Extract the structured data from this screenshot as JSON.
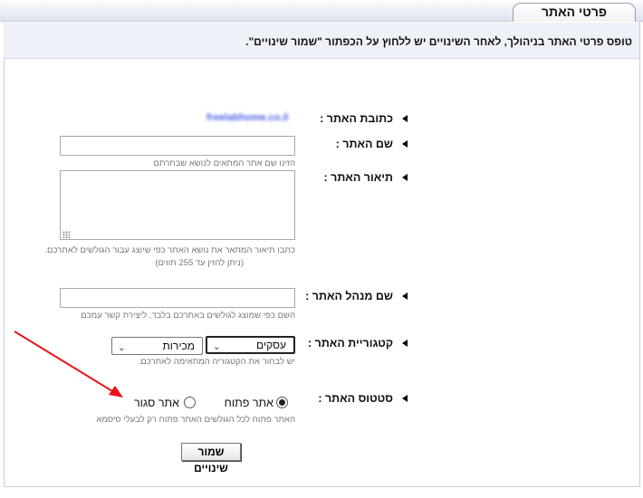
{
  "header": {
    "tab_title": "פרטי האתר"
  },
  "info": {
    "text": "טופס פרטי האתר בניהולך, לאחר השינויים יש ללחוץ על הכפתור \"שמור שינויים\"."
  },
  "form": {
    "site_address": {
      "label": "כתובת האתר :",
      "value": "freelabhome.co.il"
    },
    "site_name": {
      "label": "שם האתר :",
      "value": "",
      "help": "הזינו שם אתר המתאים לנושא שבחרתם"
    },
    "site_description": {
      "label": "תיאור האתר :",
      "value": "",
      "help1": "כתבו תיאור המתאר את נושא האתר כפי שיוצג עבור הגולשים לאתרכם.",
      "help2": "(ניתן להזין עד 255 תווים)"
    },
    "admin_name": {
      "label": "שם מנהל האתר :",
      "value": "",
      "help": "השם כפי שמוצג לגולשים באתרכם בלבד, ליצירת קשר עמכם"
    },
    "category": {
      "label": "קטגוריית האתר :",
      "main_value": "עסקים",
      "sub_value": "מכירות",
      "help": "יש לבחור את הקטגוריה המתאימה לאתרכם."
    },
    "site_status": {
      "label": "סטטוס האתר :",
      "open_label": "אתר פתוח",
      "closed_label": "אתר סגור",
      "selected": "open",
      "help": "האתר פתוח לכל הגולשים האתר פתוח רק לבעלי סיסמא"
    }
  },
  "buttons": {
    "save_label": "שמור שינויים"
  },
  "colors": {
    "annotation_arrow": "#e8141b",
    "url_text": "#4a63e6"
  }
}
